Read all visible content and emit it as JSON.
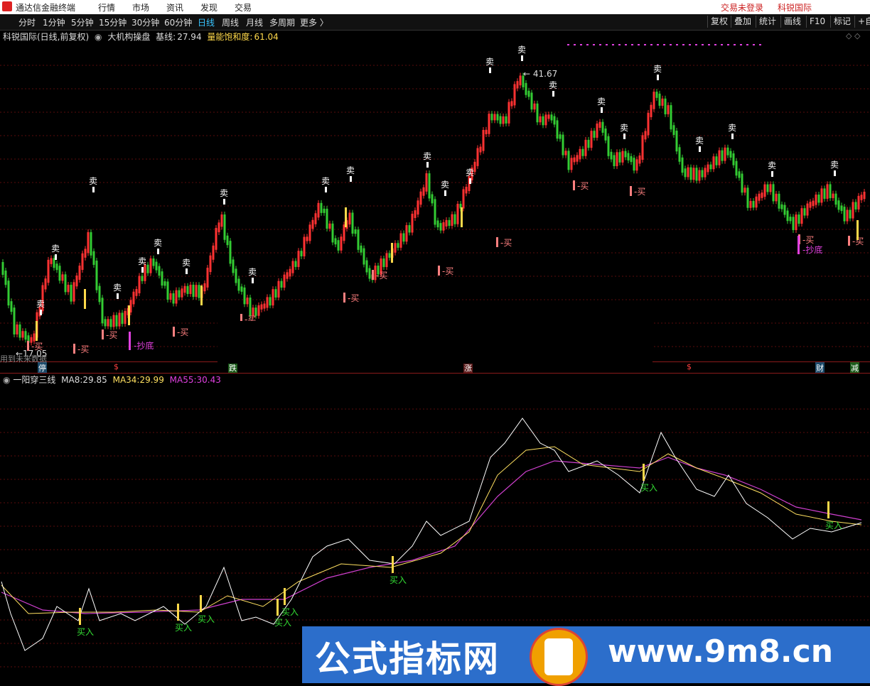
{
  "titlebar": {
    "app_name": "通达信金融终端",
    "menu": [
      "行情",
      "市场",
      "资讯",
      "发现",
      "交易"
    ],
    "login_status": "交易未登录",
    "stock_name": "科锐国际"
  },
  "toolbar": {
    "periods": [
      "分时",
      "1分钟",
      "5分钟",
      "15分钟",
      "30分钟",
      "60分钟",
      "日线",
      "周线",
      "月线",
      "多周期",
      "更多 〉"
    ],
    "active_period": "日线",
    "right_buttons": [
      "复权",
      "叠加",
      "统计",
      "画线",
      "F10",
      "标记",
      "+自"
    ]
  },
  "main_info": {
    "stock": "科锐国际(日线,前复权)",
    "indicator": "大机构操盘",
    "baseline_label": "基线:",
    "baseline_value": "27.94",
    "energy_label": "量能饱和度:",
    "energy_value": "61.04"
  },
  "main_chart": {
    "high_label": "41.67",
    "low_label": "17.05",
    "sell_label": "卖",
    "buy_label": "买",
    "bottom_label": "抄底",
    "bottom_note": "用到未来数据"
  },
  "date_markers": [
    "停",
    "$",
    "跌",
    "涨",
    "$",
    "财",
    "减"
  ],
  "sub_info": {
    "indicator": "一阳穿三线",
    "ma8_label": "MA8:",
    "ma8_value": "29.85",
    "ma34_label": "MA34:",
    "ma34_value": "29.99",
    "ma55_label": "MA55:",
    "ma55_value": "30.43"
  },
  "sub_chart": {
    "buy_in_label": "买入"
  },
  "watermark": {
    "text": "公式指标网",
    "url": "www.9m8.cn"
  },
  "colors": {
    "up": "#ff3232",
    "down": "#33cc33",
    "sell_tag": "#ffffff",
    "buy_tag": "#ff8080",
    "yellow": "#ffd94a",
    "magenta": "#e040e0",
    "grid": "#5a0d0d",
    "ma8": "#ffffff",
    "ma34": "#ffe060",
    "ma55": "#d040d0"
  }
}
